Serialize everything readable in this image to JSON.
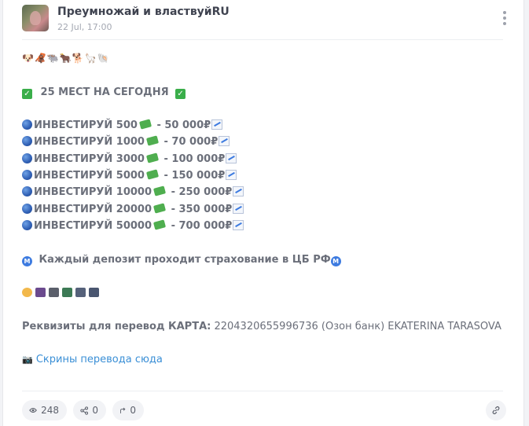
{
  "post": {
    "channel_name": "Преумножай и властвуйRU",
    "date": "22 Jul, 17:00",
    "animal_emojis": "🐶🦧🐃🐂🐕🦙🐚",
    "headline": "25 МЕСТ НА СЕГОДНЯ",
    "invest_lines": [
      {
        "label": "ИНВЕСТИРУЙ 500",
        "result": "- 50 000₽"
      },
      {
        "label": "ИНВЕСТИРУЙ 1000",
        "result": "- 70 000₽"
      },
      {
        "label": "ИНВЕСТИРУЙ 3000",
        "result": "- 100 000₽"
      },
      {
        "label": "ИНВЕСТИРУЙ 5000",
        "result": "- 150 000₽"
      },
      {
        "label": "ИНВЕСТИРУЙ 10000",
        "result": "- 250 000₽"
      },
      {
        "label": "ИНВЕСТИРУЙ 20000",
        "result": "- 350 000₽"
      },
      {
        "label": "ИНВЕСТИРУЙ 50000",
        "result": "- 700 000₽"
      }
    ],
    "insurance_text": "Каждый депозит проходит страхование в ЦБ РФ",
    "insurance_badge": "M",
    "requisites_label": "Реквизиты для перевод КАРТА:",
    "requisites_value": " 2204320655996736 (Озон банк) EKATERINA TARASOVA",
    "screenshots_link": "Скрины перевода сюда",
    "camera_emoji": "📷"
  },
  "footer": {
    "views": "248",
    "shares": "0",
    "forwards": "0"
  },
  "colors": {
    "link": "#3a8fd6",
    "check_green": "#3aae4a",
    "accent_blue": "#3d7be0"
  }
}
